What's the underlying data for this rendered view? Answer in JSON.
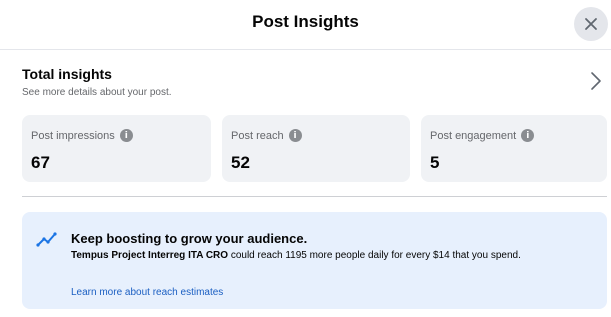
{
  "header": {
    "title": "Post Insights",
    "close_icon": "close-icon"
  },
  "total_insights": {
    "title": "Total insights",
    "subtitle": "See more details about your post.",
    "chevron_icon": "chevron-right-icon"
  },
  "stats": [
    {
      "label": "Post impressions",
      "value": "67",
      "icon": "info-icon"
    },
    {
      "label": "Post reach",
      "value": "52",
      "icon": "info-icon"
    },
    {
      "label": "Post engagement",
      "value": "5",
      "icon": "info-icon"
    }
  ],
  "boost": {
    "icon": "trend-up-icon",
    "title": "Keep boosting to grow your audience.",
    "page_name": "Tempus Project Interreg ITA CRO",
    "body": " could reach 1195 more people daily for every $14 that you spend.",
    "link": "Learn more about reach estimates"
  },
  "colors": {
    "card_bg": "#f0f2f5",
    "boost_bg": "#e7f0fd",
    "link": "#1b5fc2",
    "muted_text": "#65676b"
  }
}
